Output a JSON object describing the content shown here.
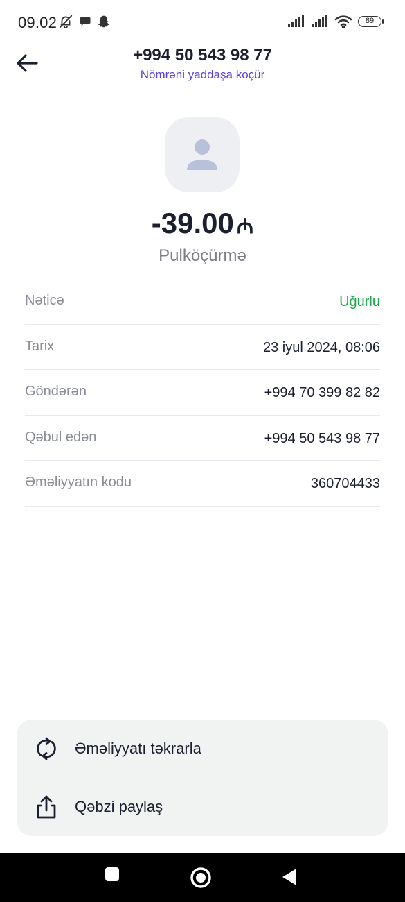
{
  "status_bar": {
    "time": "09.02",
    "battery": "89",
    "icons": [
      "bell-off-icon",
      "chat-bubble-icon",
      "snapchat-ghost-icon",
      "signal-icon",
      "signal-icon",
      "wifi-icon",
      "battery-icon"
    ]
  },
  "header": {
    "title": "+994 50 543 98 77",
    "subtitle": "Nömrəni yaddaşa köçür",
    "back_icon": "arrow-left-icon"
  },
  "summary": {
    "amount": "-39.00",
    "currency": "₼",
    "type": "Pulköçürmə"
  },
  "details": [
    {
      "label": "Nəticə",
      "value": "Uğurlu",
      "status": "success"
    },
    {
      "label": "Tarix",
      "value": "23 iyul 2024, 08:06"
    },
    {
      "label": "Göndərən",
      "value": "+994 70 399 82 82"
    },
    {
      "label": "Qəbul edən",
      "value": "+994 50 543 98 77"
    },
    {
      "label": "Əməliyyatın kodu",
      "value": "360704433"
    }
  ],
  "actions": [
    {
      "label": "Əməliyyatı təkrarla",
      "icon": "repeat-icon"
    },
    {
      "label": "Qəbzi paylaş",
      "icon": "share-icon"
    }
  ],
  "colors": {
    "accent": "#5b3fd6",
    "success": "#1aa84a",
    "text": "#1c1f2e",
    "muted": "#8a8d96",
    "panel": "#f1f2f2"
  }
}
